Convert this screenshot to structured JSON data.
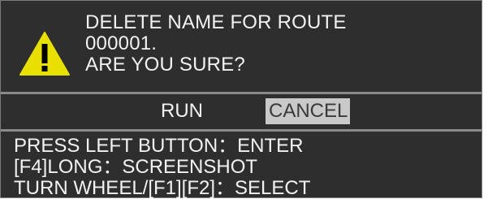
{
  "dialog": {
    "message_lines": [
      "DELETE NAME FOR ROUTE",
      "000001.",
      "ARE YOU SURE?"
    ],
    "icon": "warning-triangle-icon",
    "colors": {
      "icon_fill": "#e8e000",
      "icon_mark": "#000000",
      "background": "#2e2e2e",
      "selected_button_bg": "#c9c9c9"
    }
  },
  "buttons": {
    "run_label": "RUN",
    "cancel_label": "CANCEL",
    "selected": "CANCEL"
  },
  "help": {
    "lines": [
      "PRESS LEFT BUTTON：ENTER",
      "[F4]LONG：SCREENSHOT",
      "TURN WHEEL/[F1][F2]：SELECT"
    ]
  }
}
